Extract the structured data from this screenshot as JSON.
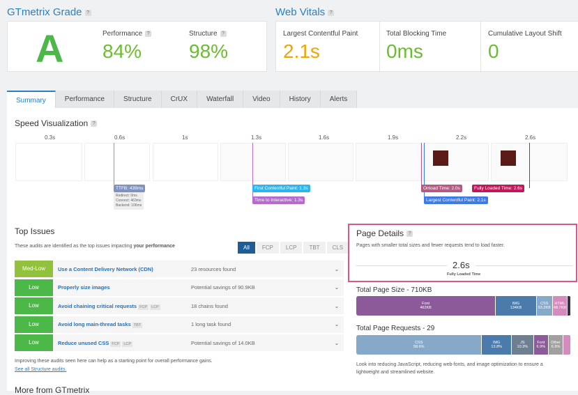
{
  "grade": {
    "title": "GTmetrix Grade",
    "letter": "A",
    "performance_label": "Performance",
    "performance": "84%",
    "structure_label": "Structure",
    "structure": "98%"
  },
  "vitals": {
    "title": "Web Vitals",
    "lcp_label": "Largest Contentful Paint",
    "lcp": "2.1s",
    "tbt_label": "Total Blocking Time",
    "tbt": "0ms",
    "cls_label": "Cumulative Layout Shift",
    "cls": "0"
  },
  "tabs": [
    "Summary",
    "Performance",
    "Structure",
    "CrUX",
    "Waterfall",
    "Video",
    "History",
    "Alerts"
  ],
  "speed": {
    "title": "Speed Visualization",
    "times": [
      "0.3s",
      "0.6s",
      "1s",
      "1.3s",
      "1.6s",
      "1.9s",
      "2.2s",
      "2.6s"
    ],
    "markers": {
      "ttfb": "TTFB: 439ms",
      "ttfb_details": [
        "Redirect: 0ms",
        "Connect: 463ms",
        "Backend: 106ms"
      ],
      "fcp": "First Contentful Paint: 1.3s",
      "tti": "Time to Interactive: 1.3s",
      "onload": "Onload Time: 2.0s",
      "lcp": "Largest Contentful Paint: 2.1s",
      "fully": "Fully Loaded Time: 2.6s"
    }
  },
  "issues": {
    "title": "Top Issues",
    "desc_pre": "These audits are identified as the top issues impacting ",
    "desc_bold": "your performance",
    "filters": [
      "All",
      "FCP",
      "LCP",
      "TBT",
      "CLS"
    ],
    "rows": [
      {
        "sev": "Med-Low",
        "name": "Use a Content Delivery Network (CDN)",
        "tags": [],
        "detail": "23 resources found"
      },
      {
        "sev": "Low",
        "name": "Properly size images",
        "tags": [],
        "detail": "Potential savings of 90.9KB"
      },
      {
        "sev": "Low",
        "name": "Avoid chaining critical requests",
        "tags": [
          "FCP",
          "LCP"
        ],
        "detail": "18 chains found"
      },
      {
        "sev": "Low",
        "name": "Avoid long main-thread tasks",
        "tags": [
          "TBT"
        ],
        "detail": "1 long task found"
      },
      {
        "sev": "Low",
        "name": "Reduce unused CSS",
        "tags": [
          "FCP",
          "LCP"
        ],
        "detail": "Potential savings of 14.0KB"
      }
    ],
    "footer": "Improving these audits seen here can help as a starting point for overall performance gains.",
    "link": "See all Structure audits.",
    "more": "More from GTmetrix"
  },
  "details": {
    "title": "Page Details",
    "desc": "Pages with smaller total sizes and fewer requests tend to load faster.",
    "fully_loaded": "2.6s",
    "fully_loaded_label": "Fully Loaded Time",
    "size_title": "Total Page Size - 710KB",
    "size": [
      {
        "name": "Font",
        "value": "462KB",
        "pct": 65,
        "color": "#8c5a99"
      },
      {
        "name": "IMG",
        "value": "134KB",
        "pct": 19,
        "color": "#4a7bab"
      },
      {
        "name": "CSS",
        "value": "53.2KB",
        "pct": 7.5,
        "color": "#86a9c9"
      },
      {
        "name": "HTML",
        "value": "48.7KB",
        "pct": 6.9,
        "color": "#d58bbd"
      },
      {
        "name": "",
        "value": "",
        "pct": 1.6,
        "color": "#334"
      }
    ],
    "req_title": "Total Page Requests - 29",
    "req": [
      {
        "name": "CSS",
        "value": "58.6%",
        "pct": 58.6,
        "color": "#86a9c9"
      },
      {
        "name": "IMG",
        "value": "13.8%",
        "pct": 13.8,
        "color": "#4a7bab"
      },
      {
        "name": "JS",
        "value": "10.3%",
        "pct": 10.3,
        "color": "#6e7f91"
      },
      {
        "name": "Font",
        "value": "6.9%",
        "pct": 6.9,
        "color": "#8c5a99"
      },
      {
        "name": "Other",
        "value": "6.9%",
        "pct": 6.9,
        "color": "#a0a0a0"
      },
      {
        "name": "",
        "value": "",
        "pct": 3.5,
        "color": "#d58bbd"
      }
    ],
    "advice": "Look into reducing JavaScript, reducing web-fonts, and image optimization to ensure a lightweight and streamlined website."
  }
}
